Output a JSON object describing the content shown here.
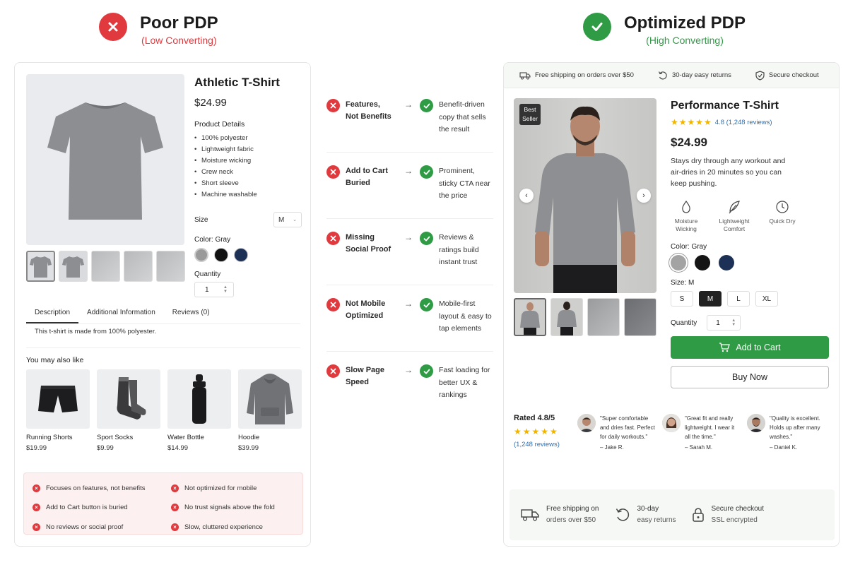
{
  "left_header": {
    "title": "Poor PDP",
    "subtitle": "(Low Converting)"
  },
  "right_header": {
    "title": "Optimized PDP",
    "subtitle": "(High Converting)"
  },
  "poor": {
    "title": "Athletic T-Shirt",
    "price": "$24.99",
    "details_heading": "Product Details",
    "details": [
      "100% polyester",
      "Lightweight fabric",
      "Moisture wicking",
      "Crew neck",
      "Short sleeve",
      "Machine washable"
    ],
    "size_label": "Size",
    "size_value": "M",
    "color_label": "Color: Gray",
    "swatches": [
      "#9a9a9a",
      "#111111",
      "#1d3157"
    ],
    "quantity_label": "Quantity",
    "quantity_value": "1",
    "tabs": [
      "Description",
      "Additional Information",
      "Reviews (0)"
    ],
    "tab_content": "This t-shirt is made from 100% polyester.",
    "related_title": "You may also like",
    "related": [
      {
        "name": "Running Shorts",
        "price": "$19.99",
        "icon": "shorts-icon"
      },
      {
        "name": "Sport Socks",
        "price": "$9.99",
        "icon": "socks-icon"
      },
      {
        "name": "Water Bottle",
        "price": "$14.99",
        "icon": "bottle-icon"
      },
      {
        "name": "Hoodie",
        "price": "$39.99",
        "icon": "hoodie-icon"
      }
    ],
    "issues": [
      "Focuses on features, not benefits",
      "Not optimized for mobile",
      "Add to Cart button is buried",
      "No trust signals above the fold",
      "No reviews or social proof",
      "Slow, cluttered experience"
    ]
  },
  "comparison": [
    {
      "bad": "Features, Not Benefits",
      "good": "Benefit-driven copy that sells the result"
    },
    {
      "bad": "Add to Cart Buried",
      "good": "Prominent, sticky CTA near the price"
    },
    {
      "bad": "Missing Social Proof",
      "good": "Reviews & ratings build instant trust"
    },
    {
      "bad": "Not Mobile Optimized",
      "good": "Mobile-first layout & easy to tap elements"
    },
    {
      "bad": "Slow Page Speed",
      "good": "Fast loading for better UX & rankings"
    }
  ],
  "optimized": {
    "trust_bar": [
      "Free shipping on orders over $50",
      "30-day easy returns",
      "Secure checkout"
    ],
    "badge": "Best Seller",
    "title": "Performance T-Shirt",
    "rating_text": "4.8 (1,248 reviews)",
    "price": "$24.99",
    "description": "Stays dry through any workout and air-dries in 20 minutes so you can keep pushing.",
    "features": [
      "Moisture Wicking",
      "Lightweight Comfort",
      "Quick Dry"
    ],
    "color_label": "Color: Gray",
    "swatches": [
      "#a3a3a3",
      "#151515",
      "#1d3157"
    ],
    "size_label": "Size: M",
    "sizes": [
      "S",
      "M",
      "L",
      "XL"
    ],
    "quantity_label": "Quantity",
    "quantity_value": "1",
    "cart_label": "Add to Cart",
    "buy_label": "Buy Now",
    "rated_title": "Rated 4.8/5",
    "rated_link": "(1,248 reviews)",
    "reviews": [
      {
        "text": "\"Super comfortable and dries fast. Perfect for daily workouts.\"",
        "author": "– Jake R."
      },
      {
        "text": "\"Great fit and really lightweight. I wear it all the time.\"",
        "author": "– Sarah M."
      },
      {
        "text": "\"Quality is excellent. Holds up after many washes.\"",
        "author": "– Daniel K."
      }
    ],
    "bottom": [
      {
        "title": "Free shipping on",
        "sub": "orders over $50"
      },
      {
        "title": "30-day",
        "sub": "easy returns"
      },
      {
        "title": "Secure checkout",
        "sub": "SSL encrypted"
      }
    ]
  },
  "colors": {
    "bad": "#e0393e",
    "good": "#2f9b45",
    "star": "#f0b400",
    "link": "#2f6fb0"
  }
}
